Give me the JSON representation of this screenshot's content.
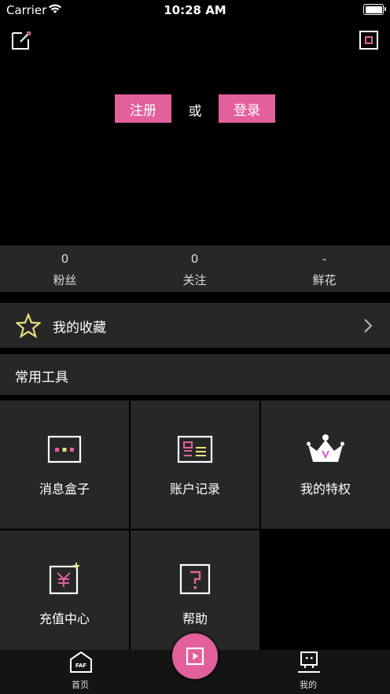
{
  "status_bar": {
    "carrier": "Carrier",
    "time": "10:28 AM"
  },
  "auth": {
    "register_label": "注册",
    "or_label": "或",
    "login_label": "登录"
  },
  "stats": [
    {
      "value": "0",
      "label": "粉丝"
    },
    {
      "value": "0",
      "label": "关注"
    },
    {
      "value": "-",
      "label": "鲜花"
    }
  ],
  "favorites": {
    "label": "我的收藏",
    "icon": "star-icon"
  },
  "tools": {
    "title": "常用工具",
    "items": [
      {
        "label": "消息盒子",
        "icon": "message-box-icon"
      },
      {
        "label": "账户记录",
        "icon": "account-record-icon"
      },
      {
        "label": "我的特权",
        "icon": "crown-icon"
      },
      {
        "label": "充值中心",
        "icon": "recharge-icon"
      },
      {
        "label": "帮助",
        "icon": "help-icon"
      }
    ]
  },
  "tabbar": {
    "home_label": "首页",
    "home_icon_text": "FAF",
    "mine_label": "我的"
  },
  "colors": {
    "accent": "#e3609c",
    "panel": "#272727",
    "star": "#e8e07a",
    "crown_accent": "#d95fd0"
  }
}
